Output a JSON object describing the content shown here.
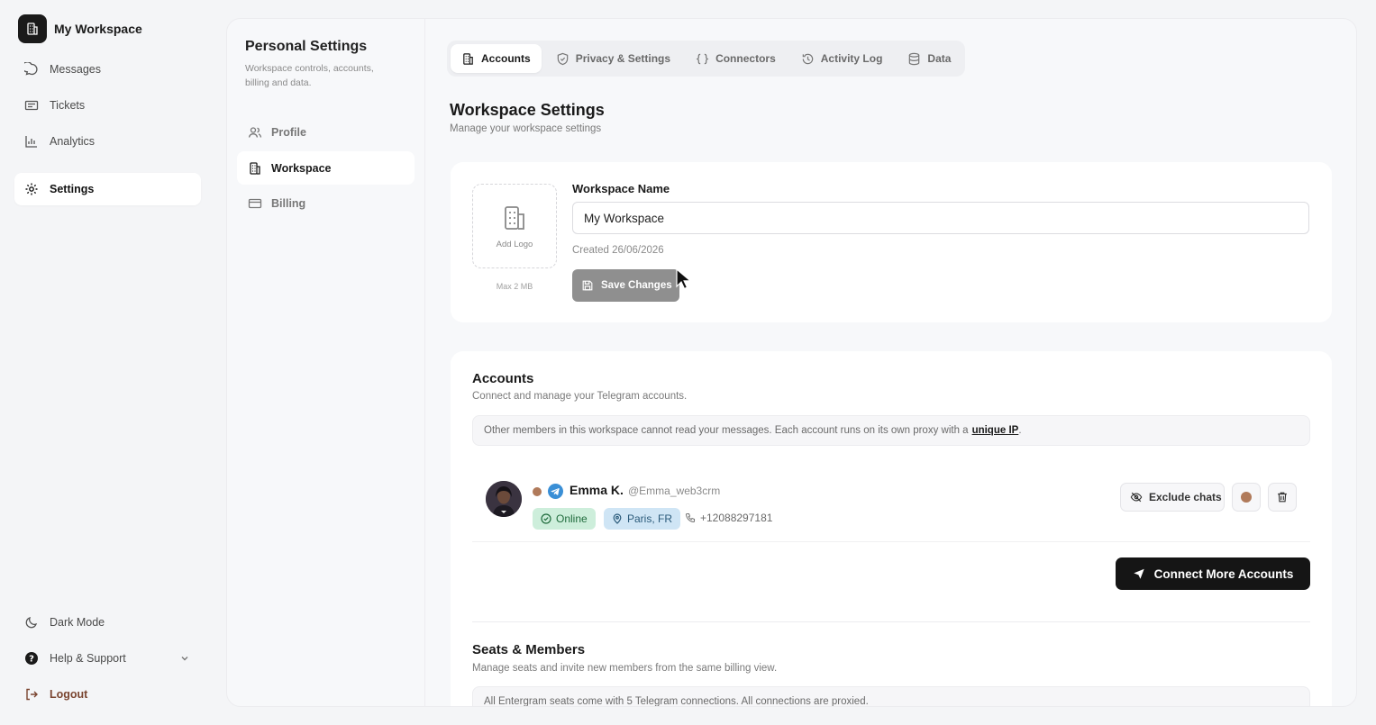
{
  "workspace": {
    "name": "My Workspace"
  },
  "nav": {
    "top": [
      {
        "label": "Messages",
        "icon": "message-icon"
      },
      {
        "label": "Tickets",
        "icon": "ticket-icon"
      },
      {
        "label": "Analytics",
        "icon": "chart-icon"
      },
      {
        "label": "Settings",
        "icon": "gear-icon",
        "active": true
      }
    ],
    "bottom": {
      "dark_mode": "Dark Mode",
      "help": "Help & Support",
      "logout": "Logout"
    }
  },
  "subnav": {
    "title": "Personal Settings",
    "description": "Workspace controls, accounts, billing and data.",
    "items": [
      {
        "label": "Profile",
        "icon": "users-icon"
      },
      {
        "label": "Workspace",
        "icon": "building-icon",
        "active": true
      },
      {
        "label": "Billing",
        "icon": "card-icon"
      }
    ]
  },
  "tabs": [
    {
      "label": "Accounts",
      "icon": "building-icon",
      "active": true
    },
    {
      "label": "Privacy & Settings",
      "icon": "shield-icon"
    },
    {
      "label": "Connectors",
      "icon": "braces-icon"
    },
    {
      "label": "Activity Log",
      "icon": "history-icon"
    },
    {
      "label": "Data",
      "icon": "database-icon"
    }
  ],
  "page": {
    "title": "Workspace Settings",
    "subtitle": "Manage your workspace settings"
  },
  "workspace_card": {
    "add_logo": "Add Logo",
    "max_size": "Max 2 MB",
    "name_label": "Workspace Name",
    "name_value": "My Workspace",
    "created": "Created 26/06/2026",
    "save_label": "Save Changes"
  },
  "accounts": {
    "title": "Accounts",
    "subtitle": "Connect and manage your Telegram accounts.",
    "notice": "Other members in this workspace cannot read your messages. Each account runs on its own proxy with a",
    "notice_link": "unique IP",
    "notice_end": ".",
    "list": [
      {
        "name": "Emma K.",
        "handle": "@Emma_web3crm",
        "status": "Online",
        "location": "Paris, FR",
        "phone": "+12088297181",
        "color": "#b07a5a"
      }
    ],
    "exclude_label": "Exclude chats",
    "connect_label": "Connect More Accounts"
  },
  "seats": {
    "title": "Seats & Members",
    "subtitle": "Manage seats and invite new members from the same billing view.",
    "notice": "All Entergram seats come with 5 Telegram connections. All connections are proxied."
  },
  "colors": {
    "accent_dark": "#151515",
    "online_bg": "#cdeedb",
    "location_bg": "#cfe5f5",
    "logout": "#7a4530"
  }
}
